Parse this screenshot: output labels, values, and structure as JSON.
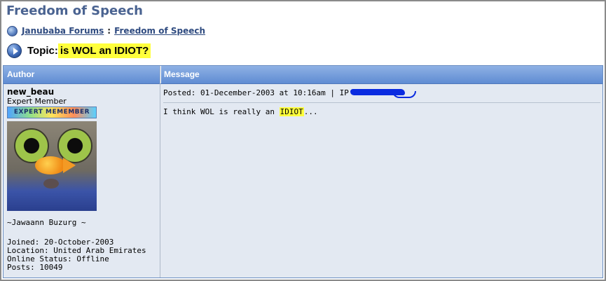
{
  "forum": {
    "title": "Freedom of Speech"
  },
  "breadcrumb": {
    "home": "Janubaba Forums",
    "separator": ":",
    "current": "Freedom of Speech"
  },
  "topic": {
    "label": "Topic:",
    "title": "is WOL an IDIOT?"
  },
  "table": {
    "col_author": "Author",
    "col_message": "Message"
  },
  "post": {
    "author": {
      "username": "new_beau",
      "rank": "Expert Member",
      "rank_badge": "EXPERT MEMEMBER",
      "signature": "~Jawaann Buzurg ~",
      "joined": "Joined: 20-October-2003",
      "location": "Location: United Arab Emirates",
      "status": "Online Status: Offline",
      "posts": "Posts: 10049"
    },
    "posted": "Posted: 01-December-2003 at 10:16am | IP",
    "body_prefix": "I think WOL is really an ",
    "body_highlight": "IDIOT",
    "body_suffix": "..."
  },
  "colors": {
    "title": "#4a6391",
    "header": "#5f8cd3",
    "highlight": "#ffff3c",
    "scribble": "#0a2be0"
  },
  "icons": [
    "globe-icon",
    "play-icon"
  ]
}
